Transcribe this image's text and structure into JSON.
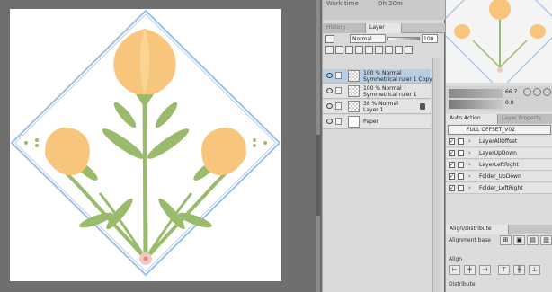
{
  "status_bar": {
    "work_time_label": "Work time",
    "work_time_value": "0h 20m"
  },
  "layer_palette": {
    "tabs": [
      "History",
      "Layer"
    ],
    "blend_mode": "Normal",
    "opacity": "100",
    "layers": [
      {
        "line1": "100 % Normal",
        "line2": "Symmetrical ruler 1 Copy",
        "selected": true
      },
      {
        "line1": "100 % Normal",
        "line2": "Symmetrical ruler 1",
        "selected": false
      },
      {
        "line1": "38 % Normal",
        "line2": "Layer 1",
        "selected": false
      },
      {
        "line1": "",
        "line2": "Paper",
        "selected": false
      }
    ]
  },
  "navigator": {
    "zoom": "66.7",
    "rotation": "0.0"
  },
  "auto_action": {
    "tabs": [
      "Auto Action",
      "Layer Property"
    ],
    "selected_set": "FULL OFFSET_V02",
    "items": [
      "LayerAllOffset",
      "LayerUpDown",
      "LayerLeftRight",
      "Folder_UpDown",
      "Folder_LeftRight"
    ]
  },
  "align_palette": {
    "tab": "Align/Distribute",
    "alignment_base_label": "Alignment base",
    "align_label": "Align",
    "distribute_label": "Distribute"
  },
  "colors": {
    "petal": "#f7c57b",
    "stem": "#9bbb6c",
    "ruler": "#9fc0e4",
    "selection": "#b7cde3"
  }
}
